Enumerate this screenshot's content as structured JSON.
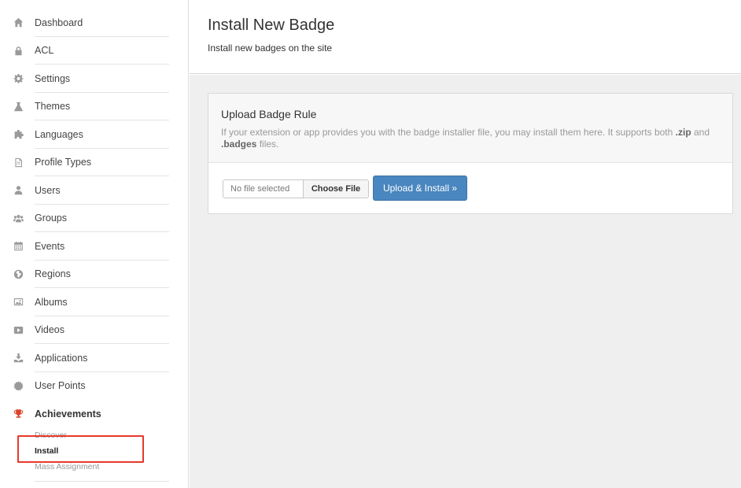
{
  "sidebar": {
    "items": [
      {
        "label": "Dashboard",
        "icon": "home-icon"
      },
      {
        "label": "ACL",
        "icon": "lock-icon"
      },
      {
        "label": "Settings",
        "icon": "gear-icon"
      },
      {
        "label": "Themes",
        "icon": "flask-icon"
      },
      {
        "label": "Languages",
        "icon": "puzzle-icon"
      },
      {
        "label": "Profile Types",
        "icon": "document-icon"
      },
      {
        "label": "Users",
        "icon": "user-icon"
      },
      {
        "label": "Groups",
        "icon": "users-icon"
      },
      {
        "label": "Events",
        "icon": "calendar-icon"
      },
      {
        "label": "Regions",
        "icon": "globe-icon"
      },
      {
        "label": "Albums",
        "icon": "picture-icon"
      },
      {
        "label": "Videos",
        "icon": "play-icon"
      },
      {
        "label": "Applications",
        "icon": "download-icon"
      },
      {
        "label": "User Points",
        "icon": "badge-icon"
      },
      {
        "label": "Achievements",
        "icon": "trophy-icon"
      }
    ],
    "subitems": [
      {
        "label": "Discover"
      },
      {
        "label": "Install"
      },
      {
        "label": "Mass Assignment"
      }
    ]
  },
  "header": {
    "title": "Install New Badge",
    "subtitle": "Install new badges on the site"
  },
  "panel": {
    "title": "Upload Badge Rule",
    "desc_before": "If your extension or app provides you with the badge installer file, you may install them here. It supports both ",
    "desc_ext1": ".zip",
    "desc_middle": " and ",
    "desc_ext2": ".badges",
    "desc_after": " files.",
    "file_status": "No file selected",
    "choose_label": "Choose File",
    "upload_label": "Upload & Install »"
  },
  "colors": {
    "accent": "#4a86bf",
    "active_icon": "#d9452b",
    "highlight": "#e8392b"
  }
}
